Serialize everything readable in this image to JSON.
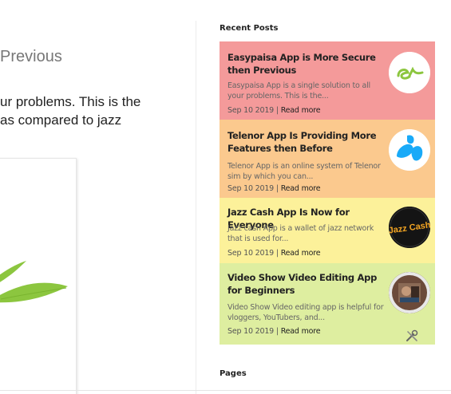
{
  "main": {
    "title_fragment": "Previous",
    "body_line1": "ur problems. This is the",
    "body_line2": "as compared to jazz"
  },
  "sidebar": {
    "recent_posts_title": "Recent Posts",
    "pages_title": "Pages",
    "posts": [
      {
        "title": "Easypaisa App is More Secure then Previous",
        "snippet": "Easypaisa App is a single solution to all your problems. This is the...",
        "date": "Sep 10 2019",
        "separator": "|",
        "read_more": "Read more",
        "bg_color": "#f49a9a",
        "thumb_icon": "easypaisa-logo"
      },
      {
        "title": "Telenor App Is Providing More Features then Before",
        "snippet": "Telenor App is an online system of Telenor sim by which you can...",
        "date": "Sep 10 2019",
        "separator": "|",
        "read_more": "Read more",
        "bg_color": "#fbc98e",
        "thumb_icon": "telenor-logo"
      },
      {
        "title": "Jazz Cash App Is Now for Everyone",
        "snippet": "Jazz cash App is a wallet of jazz network that is used for...",
        "date": "Sep 10 2019",
        "separator": "|",
        "read_more": "Read more",
        "bg_color": "#fcf19a",
        "thumb_icon": "jazzcash-logo",
        "thumb_text": "Jazz Cash"
      },
      {
        "title": "Video Show Video Editing App for Beginners",
        "snippet": "Video Show Video editing app is helpful for vloggers, YouTubers, and...",
        "date": "Sep 10 2019",
        "separator": "|",
        "read_more": "Read more",
        "bg_color": "#deeea0",
        "thumb_icon": "videoshow-thumbnail"
      }
    ]
  }
}
